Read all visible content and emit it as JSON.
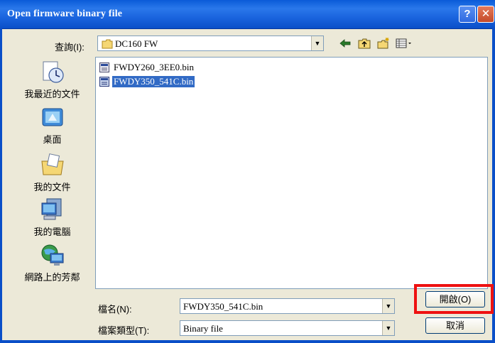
{
  "window": {
    "title": "Open firmware binary file",
    "help_glyph": "?",
    "close_glyph": "✕"
  },
  "lookin": {
    "label": "查詢(I):",
    "value": "DC160 FW",
    "dropdown_glyph": "▼"
  },
  "toolbar": {
    "icons": [
      "back-icon",
      "up-folder-icon",
      "new-folder-icon",
      "view-menu-icon"
    ]
  },
  "places": [
    {
      "label": "我最近的文件",
      "icon": "recent-documents-icon"
    },
    {
      "label": "桌面",
      "icon": "desktop-icon"
    },
    {
      "label": "我的文件",
      "icon": "my-documents-icon"
    },
    {
      "label": "我的電腦",
      "icon": "my-computer-icon"
    },
    {
      "label": "網路上的芳鄰",
      "icon": "network-places-icon"
    }
  ],
  "files": [
    {
      "name": "FWDY260_3EE0.bin",
      "selected": false
    },
    {
      "name": "FWDY350_541C.bin",
      "selected": true
    }
  ],
  "filename": {
    "label": "檔名(N):",
    "value": "FWDY350_541C.bin"
  },
  "filetype": {
    "label": "檔案類型(T):",
    "value": "Binary file"
  },
  "buttons": {
    "open": "開啟(O)",
    "cancel": "取消"
  },
  "colors": {
    "titlebar": "#0a5bd8",
    "dialog_bg": "#ece9d8",
    "selection": "#316ac5",
    "highlight": "#ee1111"
  }
}
